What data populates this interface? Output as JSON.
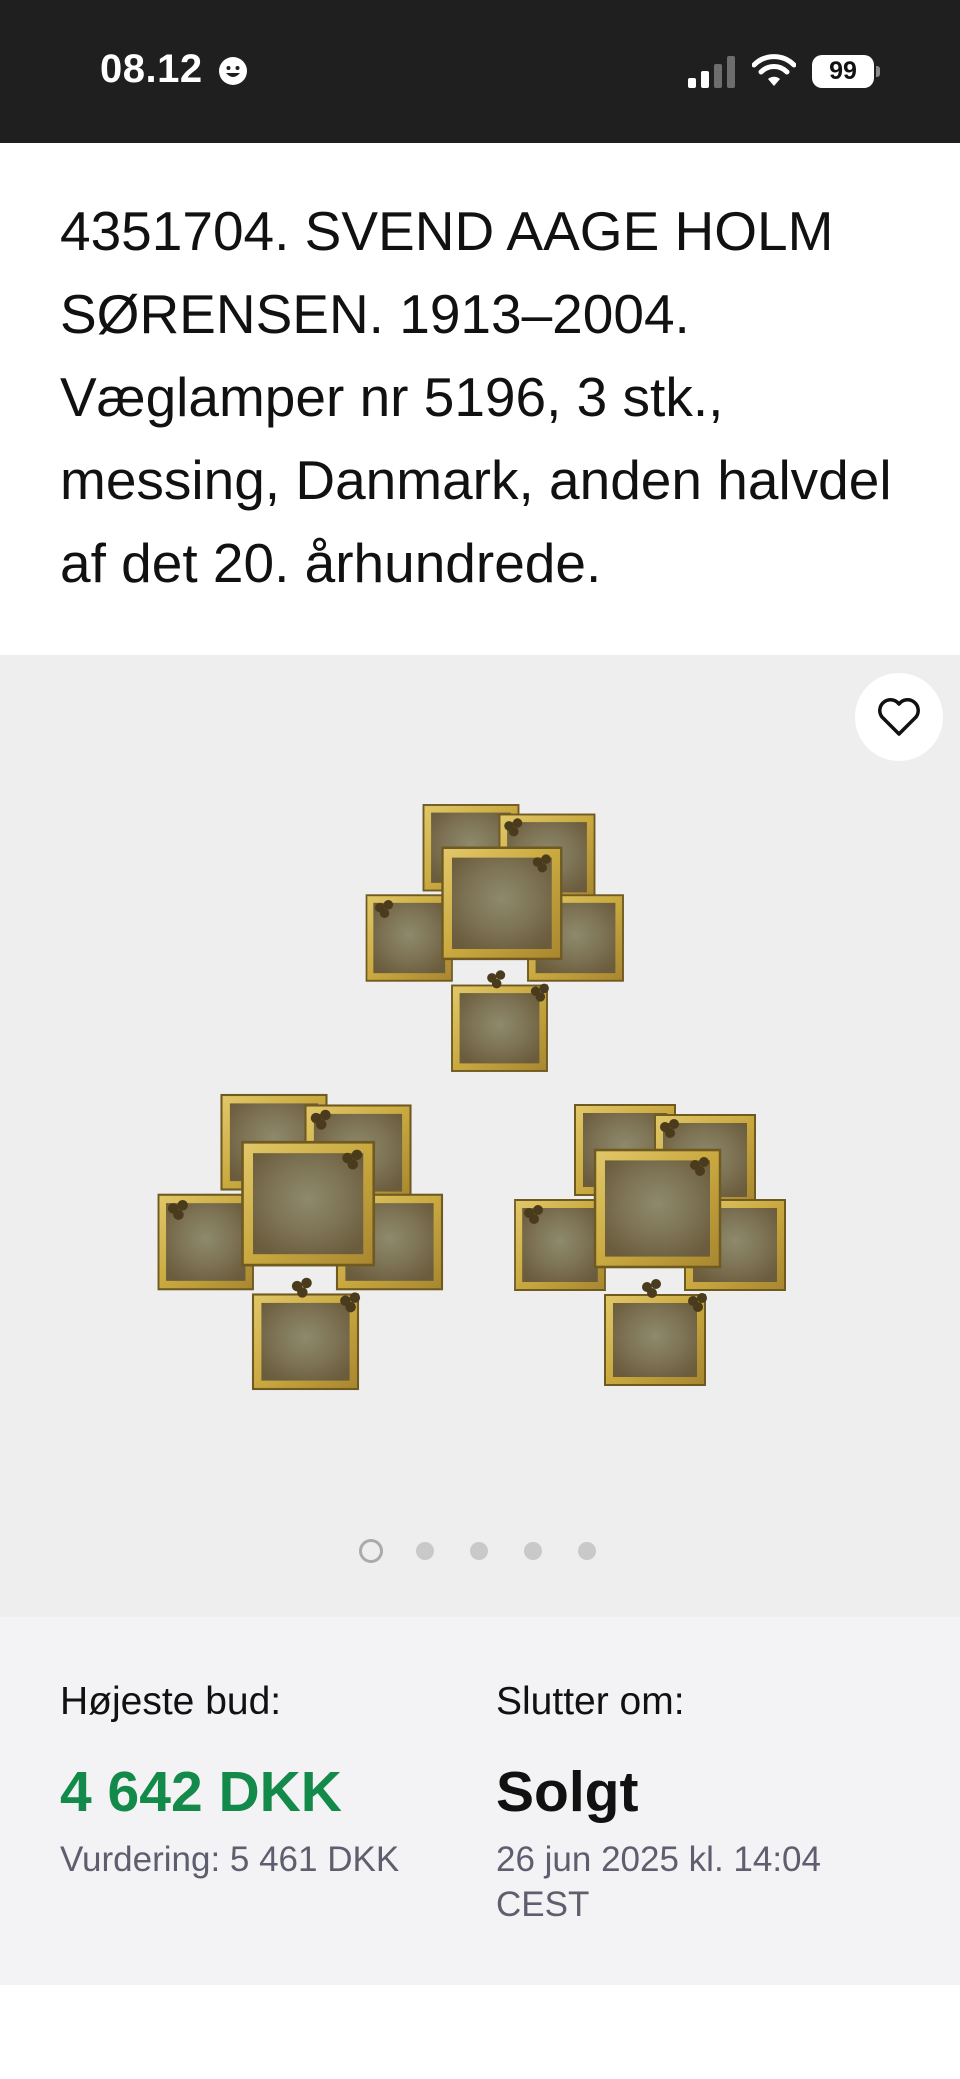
{
  "status_bar": {
    "time": "08.12",
    "battery": "99"
  },
  "listing": {
    "title": "4351704. SVEND AAGE HOLM SØRENSEN. 1913–2004. Væglamper nr 5196, 3 stk., messing, Danmark, anden halvdel af det 20. århundrede."
  },
  "gallery": {
    "image_count": 5,
    "active_index": 0
  },
  "bid": {
    "highest_label": "Højeste bud:",
    "highest_value": "4 642 DKK",
    "valuation": "Vurdering: 5 461 DKK",
    "ends_label": "Slutter om:",
    "status": "Solgt",
    "end_date_line1": "26 jun 2025 kl. 14:04",
    "end_date_line2": "CEST"
  },
  "colors": {
    "status_bar_bg": "#1f1f1f",
    "bid_green": "#138a4a",
    "panel_bg": "#f3f3f5",
    "image_bg": "#efeeee"
  },
  "icons": [
    "smiley-icon",
    "cellular-signal-icon",
    "wifi-icon",
    "battery-icon",
    "heart-icon"
  ]
}
